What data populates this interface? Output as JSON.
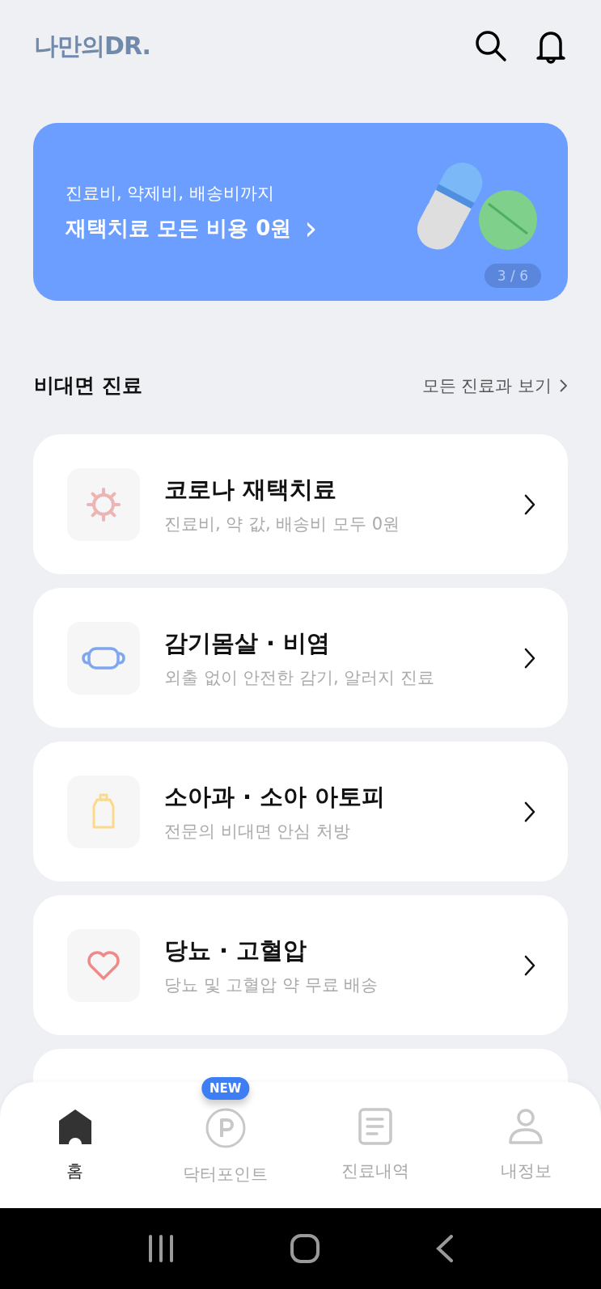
{
  "header": {
    "logo": "나만의DR."
  },
  "banner": {
    "subtitle": "진료비, 약제비, 배송비까지",
    "title": "재택치료 모든 비용 0원",
    "chevron": "›",
    "counter": "3 / 6"
  },
  "section": {
    "title": "비대면 진료",
    "link": "모든 진료과 보기"
  },
  "services": [
    {
      "title": "코로나 재택치료",
      "subtitle": "진료비, 약 값, 배송비 모두 0원"
    },
    {
      "title": "감기몸살 · 비염",
      "subtitle": "외출 없이 안전한 감기, 알러지 진료"
    },
    {
      "title": "소아과 · 소아 아토피",
      "subtitle": "전문의 비대면 안심 처방"
    },
    {
      "title": "당뇨 · 고혈압",
      "subtitle": "당뇨 및 고혈압 약 무료 배송"
    }
  ],
  "bottom_nav": [
    {
      "label": "홈",
      "selected": true
    },
    {
      "label": "닥터포인트",
      "selected": false,
      "badge": "NEW"
    },
    {
      "label": "진료내역",
      "selected": false
    },
    {
      "label": "내정보",
      "selected": false
    }
  ]
}
